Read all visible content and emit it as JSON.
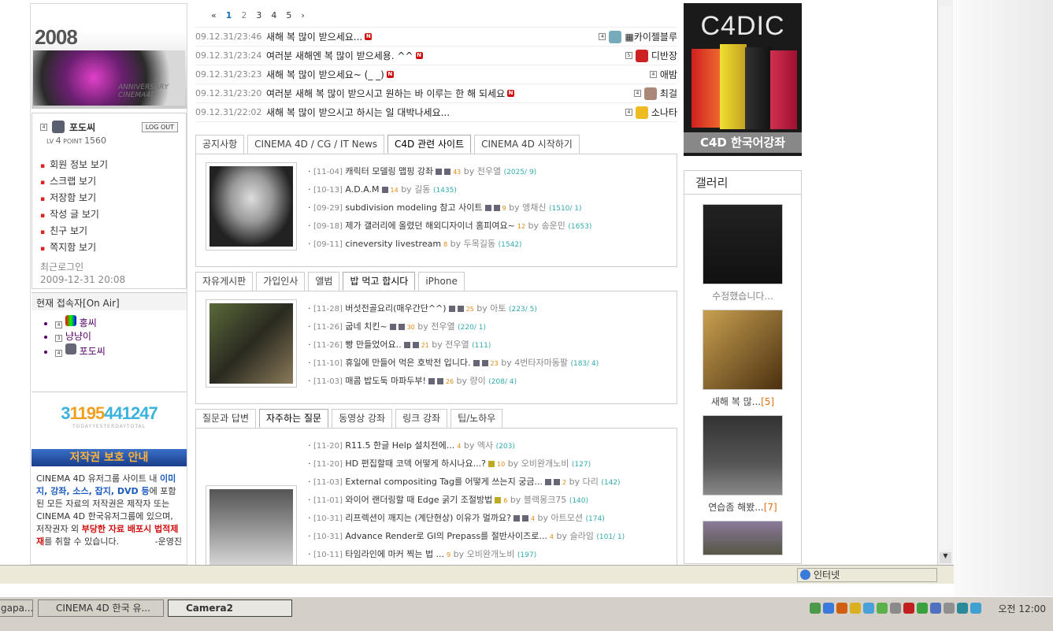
{
  "left": {
    "banner_title": "2008 DEMOREEL",
    "banner_sub": "ANNIVERSARY CINEMA4D",
    "user": {
      "nickname": "포도씨",
      "logout": "LOG OUT",
      "level_label": "LV",
      "level": "4",
      "point_label": "POINT",
      "point": "1560"
    },
    "menu": [
      "회원 정보 보기",
      "스크랩 보기",
      "저장함 보기",
      "작성 글 보기",
      "친구 보기",
      "쪽지함 보기"
    ],
    "last_login_label": "최근로그인",
    "last_login": "2009-12-31 20:08",
    "onair_title": "현재 접속자[On Air]",
    "onair_users": [
      "홍씨",
      "냥냥이",
      "포도씨"
    ],
    "counter_total": "3",
    "counter_today": "1195",
    "counter_yesterday": "441247",
    "counter_caption": "TODAYYESTERDAYTOTAL",
    "copyright_title": "저작권 보호 안내",
    "copyright_p1": "CINEMA 4D 유저그룹 사이트 내 ",
    "copyright_hl1": "이미지, 강좌, 소스, 잡지, DVD 등",
    "copyright_p2": "에 포함된 모든 자료의 저작권은 제작자 또는 CINEMA 4D 한국유저그룹에 있으며, 저작권자 외 ",
    "copyright_hl2": "부당한 자료 배포시 법적제재",
    "copyright_p3": "를 취할 수 있습니다.",
    "copyright_sig": "-운영진"
  },
  "pager": {
    "first": "«",
    "prev": "‹",
    "pages": [
      "1",
      "2",
      "3",
      "4",
      "5"
    ],
    "next": "›",
    "current": "1"
  },
  "news": [
    {
      "date": "09.12.31/23:46",
      "title": "새해 복 많이 받으세요...",
      "author": "▦카이젤블루"
    },
    {
      "date": "09.12.31/23:24",
      "title": "여러분 새해엔 복 많이 받으세용. ^^",
      "author": "디반장"
    },
    {
      "date": "09.12.31/23:23",
      "title": "새해 복 많이 받으세요~ (_ _)",
      "author": "애밤"
    },
    {
      "date": "09.12.31/23:20",
      "title": "여러분 새해 복 많이 받으시고 원하는 바 이루는 한 해 되세요",
      "author": "최걸"
    },
    {
      "date": "09.12.31/22:02",
      "title": "새해 복 많이 받으시고 하시는 일 대박나세요...",
      "author": "소나타"
    }
  ],
  "board1": {
    "tabs": [
      "공지사항",
      "CINEMA 4D / CG / IT News",
      "C4D 관련 사이트",
      "CINEMA 4D 시작하기"
    ],
    "active": 2,
    "items": [
      {
        "date": "[11-04]",
        "title": "캐릭터 모델링 맵핑 강좌",
        "rec": "43",
        "by": "by",
        "author": "전우열",
        "cnt": "(2025/ 9)"
      },
      {
        "date": "[10-13]",
        "title": "A.D.A.M",
        "rec": "14",
        "by": "by",
        "author": "길동",
        "cnt": "(1435)"
      },
      {
        "date": "[09-29]",
        "title": "subdivision modeling 참고 사이트",
        "rec": "9",
        "by": "by",
        "author": "엥채신",
        "cnt": "(1510/ 1)"
      },
      {
        "date": "[09-18]",
        "title": "제가 갤러리에 올렸던 해외디자이너 홈피여요~",
        "rec": "12",
        "by": "by",
        "author": "송운민",
        "cnt": "(1653)"
      },
      {
        "date": "[09-11]",
        "title": "cineversity livestream",
        "rec": "8",
        "by": "by",
        "author": "두목길동",
        "cnt": "(1542)"
      }
    ]
  },
  "board2": {
    "tabs": [
      "자유게시판",
      "가입인사",
      "앨범",
      "밥 먹고 합시다",
      "iPhone"
    ],
    "active": 3,
    "items": [
      {
        "date": "[11-28]",
        "title": "버섯전골요리(매우간단^^)",
        "rec": "25",
        "by": "by",
        "author": "아토",
        "cnt": "(223/ 5)"
      },
      {
        "date": "[11-26]",
        "title": "굽네 치킨~",
        "rec": "30",
        "by": "by",
        "author": "전우열",
        "cnt": "(220/ 1)"
      },
      {
        "date": "[11-26]",
        "title": "빵 만들었어요..",
        "rec": "21",
        "by": "by",
        "author": "전우열",
        "cnt": "(111)"
      },
      {
        "date": "[11-10]",
        "title": "휴일에 만들어 먹은 호박전 입니다.",
        "rec": "23",
        "by": "by",
        "author": "4번타자마동팔",
        "cnt": "(183/ 4)"
      },
      {
        "date": "[11-03]",
        "title": "매콤 밥도둑 마파두부!",
        "rec": "26",
        "by": "by",
        "author": "량이",
        "cnt": "(208/ 4)"
      }
    ]
  },
  "board3": {
    "tabs": [
      "질문과 답변",
      "자주하는 질문",
      "동영상 강좌",
      "링크 강좌",
      "팁/노하우"
    ],
    "active": 1,
    "items": [
      {
        "date": "[11-20]",
        "title": "R11.5 한글 Help 설치전에...",
        "rec": "4",
        "by": "by",
        "author": "엑사",
        "cnt": "(203)"
      },
      {
        "date": "[11-20]",
        "title": "HD 편집할때 코덱 어떻게 하시나요...?",
        "rec": "10",
        "by": "by",
        "author": "오비완개노비",
        "cnt": "(127)"
      },
      {
        "date": "[11-03]",
        "title": "External compositing Tag를 어떻게 쓰는지 궁금...",
        "rec": "2",
        "by": "by",
        "author": "다리",
        "cnt": "(142)"
      },
      {
        "date": "[11-01]",
        "title": "와이어 랜더링할 때 Edge 굵기 조절방법",
        "rec": "6",
        "by": "by",
        "author": "블랙몽크75",
        "cnt": "(140)"
      },
      {
        "date": "[10-31]",
        "title": "리프렉션이 깨지는 (계단현상) 이유가 멀까요?",
        "rec": "4",
        "by": "by",
        "author": "아트모션",
        "cnt": "(174)"
      },
      {
        "date": "[10-31]",
        "title": "Advance Render로 GI의 Prepass를 절반사이즈로...",
        "rec": "4",
        "by": "by",
        "author": "슬라임",
        "cnt": "(101/ 1)"
      },
      {
        "date": "[10-11]",
        "title": "타임라인에 마커 찍는 법 ...",
        "rec": "9",
        "by": "by",
        "author": "오비완개노비",
        "cnt": "(197)"
      }
    ]
  },
  "ad": {
    "logo": "C4DIC",
    "footer": "C4D 한국어강좌"
  },
  "gallery": {
    "title": "갤러리",
    "items": [
      {
        "caption": "수정했습니다...",
        "count": ""
      },
      {
        "caption": "새해 복 많...",
        "count": "[5]"
      },
      {
        "caption": "연습좀 해봤...",
        "count": "[7]"
      },
      {
        "caption": "",
        "count": ""
      }
    ]
  },
  "status": {
    "zone": "인터넷"
  },
  "taskbar": {
    "tasks": [
      "gapa...",
      "CINEMA 4D 한국 유...",
      "Camera2"
    ],
    "clock": "오전 12:00"
  },
  "colors": {
    "accent": "#1f6fb5",
    "new_badge": "#d01010",
    "recommend": "#e08a10"
  }
}
